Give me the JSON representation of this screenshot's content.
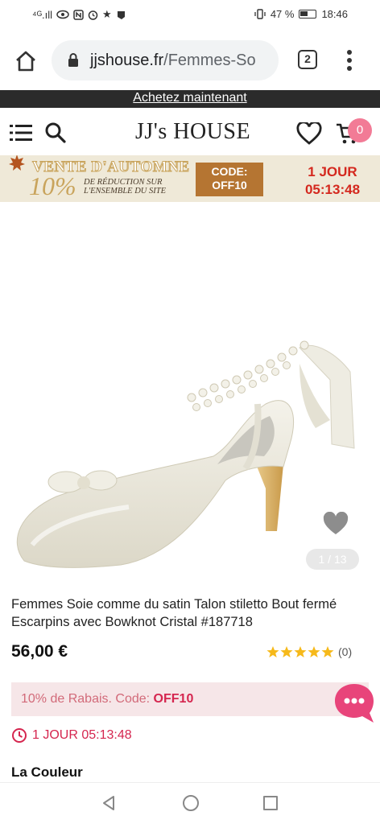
{
  "status_bar": {
    "left_text": "⁴ᴳ.ıll",
    "battery": "47 %",
    "time": "18:46"
  },
  "browser": {
    "url_host": "jjshouse.fr",
    "url_path": "/Femmes-So",
    "tab_count": "2"
  },
  "promo": {
    "link": "Achetez maintenant"
  },
  "header": {
    "logo": "JJ's HOUSE",
    "cart_count": "0"
  },
  "sale_banner": {
    "title": "VENTE D'AUTOMNE",
    "percent": "10%",
    "desc_line1": "DE RÉDUCTION SUR",
    "desc_line2": "L'ENSEMBLE DU SITE",
    "code_label": "CODE:",
    "code_value": "OFF10",
    "countdown_days": "1 JOUR",
    "countdown_time": "05:13:48"
  },
  "gallery": {
    "counter": "1 / 13"
  },
  "product": {
    "title": "Femmes Soie comme du satin Talon stiletto Bout fermé Escarpins avec Bowknot Cristal #187718",
    "price": "56,00 €",
    "rating": 5,
    "review_count": "(0)"
  },
  "discount": {
    "text": "10% de Rabais. Code: ",
    "code": "OFF10"
  },
  "timer": {
    "text": "1 JOUR 05:13:48"
  },
  "options": {
    "color_label": "La Couleur"
  },
  "colors": {
    "accent_pink": "#d5264f",
    "star_yellow": "#f6b91a",
    "sale_red": "#d4281e",
    "code_brown": "#b57532"
  }
}
